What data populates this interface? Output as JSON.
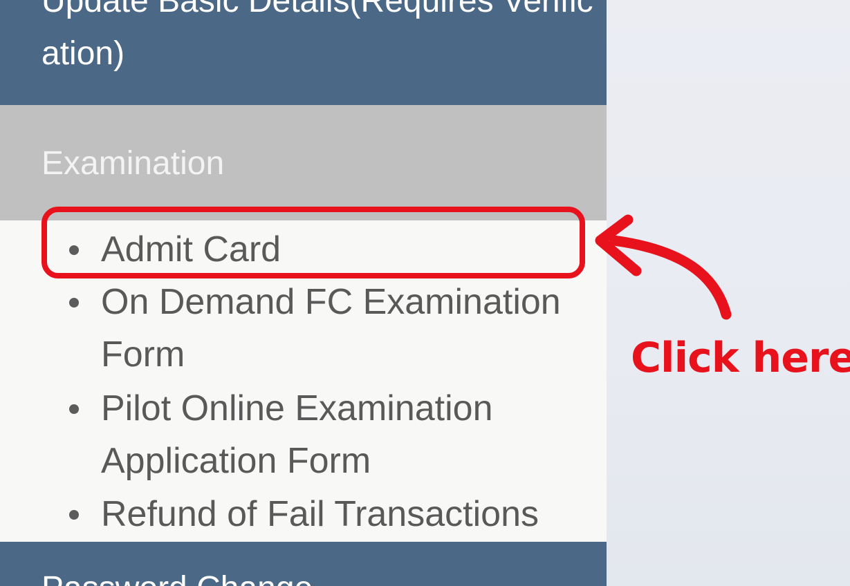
{
  "sidebar": {
    "top_section": {
      "label": "Update Basic Details(Requires Verification)"
    },
    "examination": {
      "title": "Examination",
      "items": [
        {
          "label": "Admit Card"
        },
        {
          "label": "On Demand FC Examination Form"
        },
        {
          "label": "Pilot Online Examination Application Form"
        },
        {
          "label": "Refund of Fail Transactions"
        }
      ]
    },
    "next_section": {
      "label": "Password Change"
    }
  },
  "annotation": {
    "text": "Click here",
    "color": "#e8121d"
  },
  "colors": {
    "section_blue": "#4b6886",
    "header_gray": "#c0c0c0",
    "menu_bg": "#f8f8f6",
    "menu_text": "#595959"
  }
}
